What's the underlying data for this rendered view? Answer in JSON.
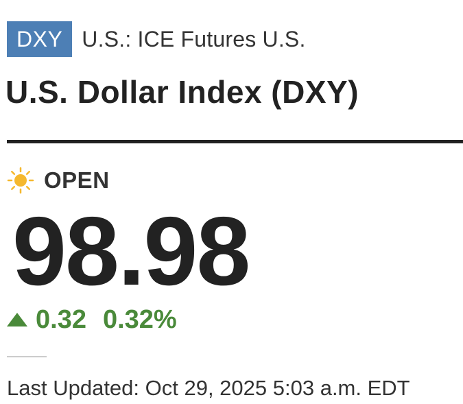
{
  "header": {
    "ticker": "DXY",
    "exchange": "U.S.: ICE Futures U.S.",
    "title": "U.S. Dollar Index (DXY)"
  },
  "status": {
    "icon": "sun-icon",
    "label": "OPEN"
  },
  "quote": {
    "price": "98.98",
    "change": "0.32",
    "change_percent": "0.32%",
    "direction": "up",
    "change_color": "#4a8a3a"
  },
  "footer": {
    "last_updated": "Last Updated: Oct 29, 2025 5:03 a.m. EDT"
  },
  "colors": {
    "badge_background": "#4d7fb5",
    "sun": "#f5b82e"
  }
}
